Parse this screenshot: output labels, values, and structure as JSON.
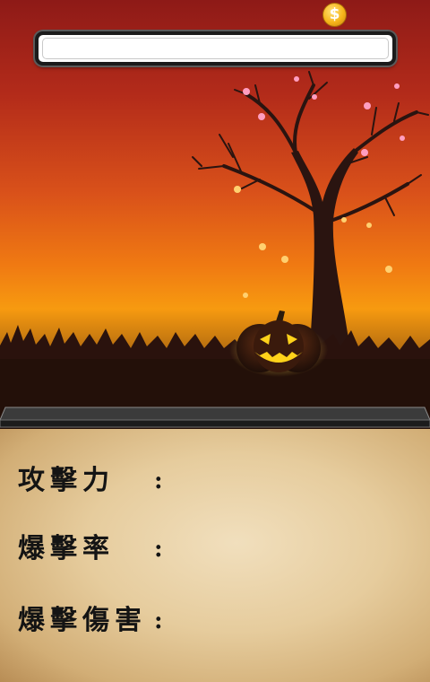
{
  "currency": {
    "icon": "dollar-coin-icon",
    "symbol": "$"
  },
  "stats": [
    {
      "label": "攻擊力",
      "separator": ":"
    },
    {
      "label": "爆擊率",
      "separator": ":"
    },
    {
      "label": "爆擊傷害",
      "separator": ":"
    }
  ],
  "colors": {
    "sky_top": "#8e1a17",
    "sky_bottom": "#f79a10",
    "pumpkin_glow": "#ffd21a",
    "parchment": "#e6cc9d"
  }
}
